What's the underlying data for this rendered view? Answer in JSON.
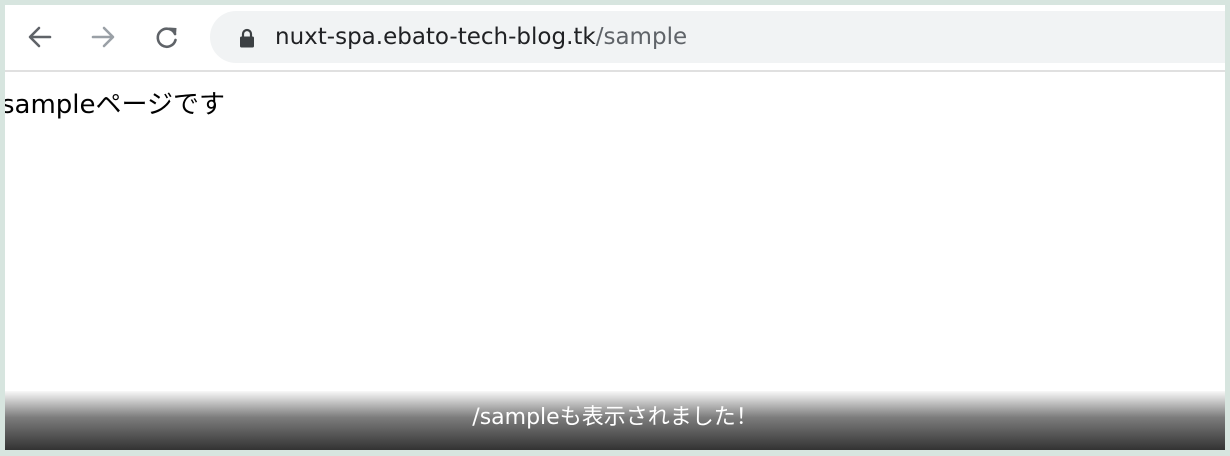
{
  "browser": {
    "url_host": "nuxt-spa.ebato-tech-blog.tk",
    "url_path": "/sample",
    "icons": {
      "back": "arrow-left-icon",
      "forward": "arrow-right-icon",
      "reload": "reload-icon",
      "secure": "lock-icon"
    }
  },
  "page": {
    "text": "sampleページです"
  },
  "caption": {
    "text": "/sampleも表示されました！"
  },
  "colors": {
    "frame_background": "#d7e5df",
    "omnibox_background": "#f1f3f4",
    "url_host": "#202124",
    "url_path": "#5f6368",
    "forward_icon_disabled": "#9aa0a6"
  }
}
